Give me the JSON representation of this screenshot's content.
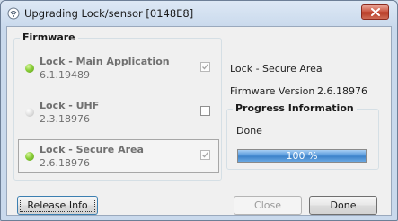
{
  "window": {
    "title": "Upgrading Lock/sensor [0148E8]"
  },
  "firmware": {
    "legend": "Firmware",
    "items": [
      {
        "name": "Lock - Main Application",
        "version": "6.1.19489",
        "led": "green",
        "checked": true
      },
      {
        "name": "Lock - UHF",
        "version": "2.3.18976",
        "led": "grey",
        "checked": false
      },
      {
        "name": "Lock - Secure Area",
        "version": "2.6.18976",
        "led": "green",
        "checked": true
      }
    ]
  },
  "details": {
    "name": "Lock - Secure Area",
    "version_label": "Firmware Version",
    "version_value": "2.6.18976"
  },
  "progress": {
    "legend": "Progress Information",
    "status": "Done",
    "percent": 100,
    "percent_label": "100 %"
  },
  "buttons": {
    "release_info": "Release Info",
    "close": "Close",
    "done": "Done"
  },
  "colors": {
    "progress_fill": "#3b80c8",
    "led_green": "#8bcf3a",
    "close_button": "#c9513c"
  }
}
